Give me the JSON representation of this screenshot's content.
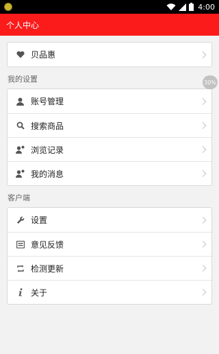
{
  "status_bar": {
    "time": "4:00"
  },
  "app_bar": {
    "title": "个人中心"
  },
  "top_card": {
    "items": [
      {
        "label": "贝品惠",
        "icon": "heart-icon"
      }
    ]
  },
  "my_settings": {
    "header": "我的设置",
    "items": [
      {
        "label": "账号管理",
        "icon": "user-icon"
      },
      {
        "label": "搜索商品",
        "icon": "search-icon"
      },
      {
        "label": "浏览记录",
        "icon": "user-history-icon"
      },
      {
        "label": "我的消息",
        "icon": "user-message-icon"
      }
    ]
  },
  "client": {
    "header": "客户端",
    "items": [
      {
        "label": "设置",
        "icon": "wrench-icon"
      },
      {
        "label": "意见反馈",
        "icon": "feedback-icon"
      },
      {
        "label": "检测更新",
        "icon": "refresh-icon"
      },
      {
        "label": "关于",
        "icon": "info-icon"
      }
    ]
  },
  "floating_badge": {
    "text": "30%"
  },
  "colors": {
    "app_bar": "#fb1b1b",
    "status_bar": "#000000",
    "background": "#f2f2f2",
    "icon": "#555555"
  }
}
